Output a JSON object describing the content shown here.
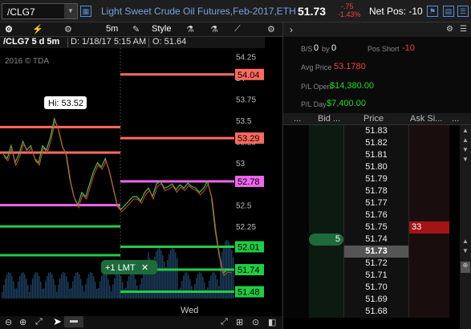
{
  "topbar": {
    "symbol": "/CLG7",
    "description": "Light Sweet Crude Oil Futures,Feb-2017,ETH",
    "last": "51.73",
    "change": "-.75",
    "change_pct": "-1.43%",
    "net_pos": "Net Pos: -10"
  },
  "chart_toolbar": {
    "timeframe": "5m",
    "style_label": "Style"
  },
  "chart_info": {
    "symbol_period": "/CLG7 5 d 5m",
    "date": "D: 1/18/17 5:15 AM",
    "open": "O: 51.64",
    "copyright": "2016 © TDA",
    "hi_label": "Hi: 53.52",
    "order_label": "+1 LMT",
    "order_close": "✕",
    "day_label": "Wed"
  },
  "chart_data": {
    "type": "line",
    "y_ticks": [
      "54.25",
      "54",
      "53.75",
      "53.5",
      "53.25",
      "53",
      "52.75",
      "52.5",
      "52.25",
      "52",
      "51.75",
      "51.5"
    ],
    "ylim": [
      51.4,
      54.35
    ],
    "price_tags": [
      {
        "value": "54.04",
        "color": "#ff6b5e"
      },
      {
        "value": "53.29",
        "color": "#ff6b5e"
      },
      {
        "value": "52.78",
        "color": "#ee66ee"
      },
      {
        "value": "52.01",
        "color": "#22cc44"
      },
      {
        "value": "51.74",
        "color": "#22cc44"
      },
      {
        "value": "51.48",
        "color": "#22cc44"
      }
    ],
    "x_label": "Wed",
    "series": [
      {
        "values": [
          53.1,
          53.05,
          53.2,
          53.0,
          53.1,
          53.25,
          53.15,
          53.2,
          53.05,
          53.0,
          53.2,
          53.15,
          53.3,
          53.52,
          53.4,
          53.2,
          53.1,
          52.8,
          52.6,
          52.5,
          52.65,
          52.6,
          52.75,
          52.9,
          53.0,
          52.95,
          53.05,
          52.9,
          52.7,
          52.5,
          52.45,
          52.5,
          52.55,
          52.6,
          52.6,
          52.55,
          52.65,
          52.7,
          52.6,
          52.75,
          52.78,
          52.7,
          52.72,
          52.75,
          52.68,
          52.74,
          52.7,
          52.76,
          52.72,
          52.7,
          52.65,
          52.7,
          52.78,
          52.6,
          52.2,
          51.9,
          51.7,
          51.74,
          51.73
        ]
      }
    ]
  },
  "stats": {
    "bs_label": "B/S",
    "bs_val1": "0",
    "bs_by": "by",
    "bs_val2": "0",
    "pos_short_label": "Pos Short",
    "pos_short_val": "-10",
    "avg_price_label": "Avg Price",
    "avg_price_val": "53.1780",
    "pl_open_label": "P/L Open",
    "pl_open_val": "$14,380.00",
    "pl_day_label": "P/L Day",
    "pl_day_val": "$7,400.00"
  },
  "ladder": {
    "col_dots1": "...",
    "col_bid": "Bid ...",
    "col_price": "Price",
    "col_ask": "Ask Si...",
    "col_dots2": "...",
    "rows": [
      {
        "price": "51.83",
        "bid": "",
        "ask": ""
      },
      {
        "price": "51.82",
        "bid": "",
        "ask": ""
      },
      {
        "price": "51.81",
        "bid": "",
        "ask": ""
      },
      {
        "price": "51.80",
        "bid": "",
        "ask": ""
      },
      {
        "price": "51.79",
        "bid": "",
        "ask": ""
      },
      {
        "price": "51.78",
        "bid": "",
        "ask": ""
      },
      {
        "price": "51.77",
        "bid": "",
        "ask": ""
      },
      {
        "price": "51.76",
        "bid": "",
        "ask": ""
      },
      {
        "price": "51.75",
        "bid": "",
        "ask": "33"
      },
      {
        "price": "51.74",
        "bid": "5",
        "ask": ""
      },
      {
        "price": "51.73",
        "bid": "",
        "ask": ""
      },
      {
        "price": "51.72",
        "bid": "",
        "ask": ""
      },
      {
        "price": "51.71",
        "bid": "",
        "ask": ""
      },
      {
        "price": "51.70",
        "bid": "",
        "ask": ""
      },
      {
        "price": "51.69",
        "bid": "",
        "ask": ""
      },
      {
        "price": "51.68",
        "bid": "",
        "ask": ""
      }
    ]
  }
}
